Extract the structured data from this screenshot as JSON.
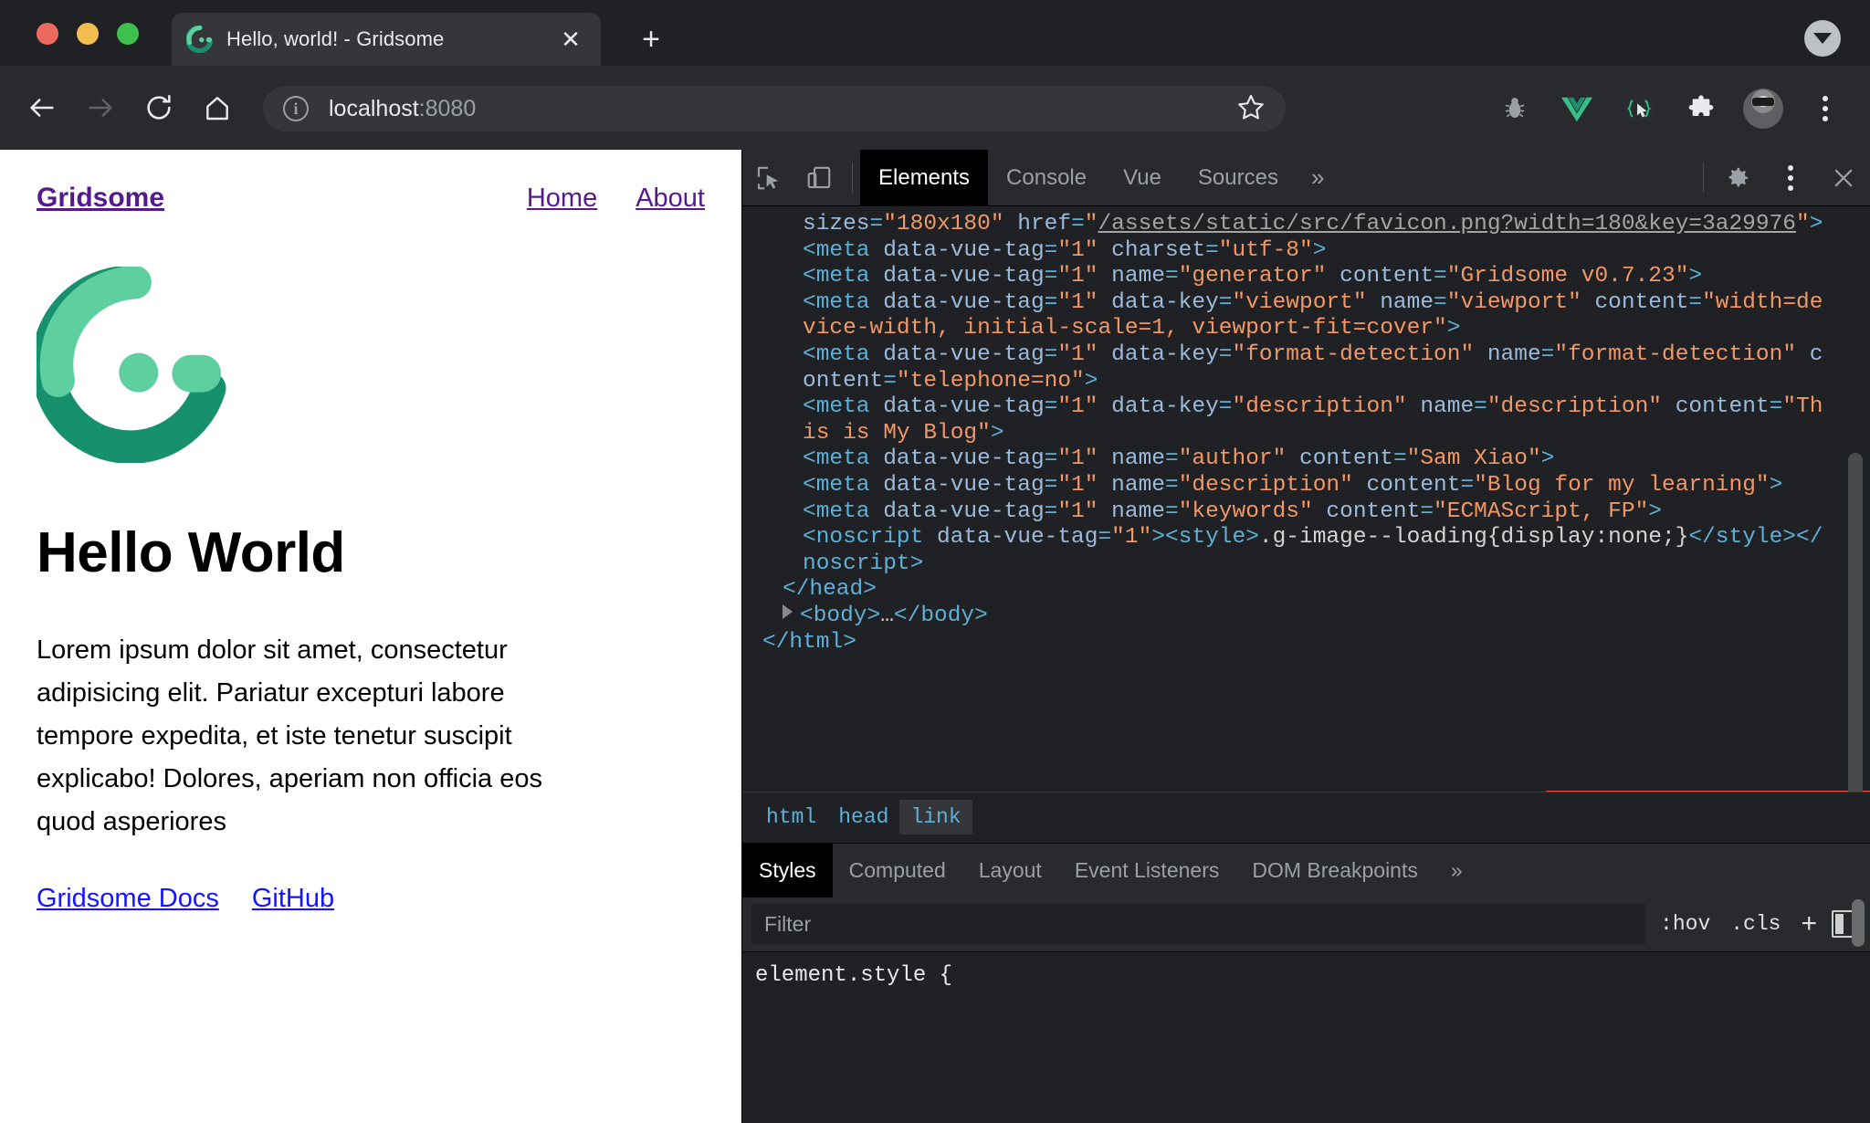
{
  "browser": {
    "window_controls": [
      "close",
      "minimize",
      "maximize"
    ],
    "tab": {
      "title": "Hello, world! - Gridsome",
      "favicon": "gridsome-logo-icon",
      "close_label": "✕"
    },
    "new_tab_label": "+",
    "tabstrip_caret": "chevron-down-icon",
    "nav": {
      "back": "back-arrow-icon",
      "forward": "forward-arrow-icon",
      "reload": "reload-icon",
      "home": "home-icon"
    },
    "omnibox": {
      "info_glyph": "i",
      "host": "localhost",
      "port": ":8080",
      "star": "star-icon"
    },
    "toolbar_icons": [
      "bug-icon",
      "vue-devtools-icon",
      "json-viewer-icon",
      "extensions-puzzle-icon",
      "profile-avatar",
      "chrome-menu-kebab"
    ]
  },
  "page": {
    "brand": "Gridsome",
    "nav": [
      {
        "label": "Home"
      },
      {
        "label": "About"
      }
    ],
    "logo": "gridsome-logo",
    "heading": "Hello World",
    "paragraph": "Lorem ipsum dolor sit amet, consectetur adipisicing elit. Pariatur excepturi labore tempore expedita, et iste tenetur suscipit explicabo! Dolores, aperiam non officia eos quod asperiores",
    "links": [
      {
        "label": "Gridsome Docs"
      },
      {
        "label": "GitHub"
      }
    ],
    "colors": {
      "visited_link": "#551a8b",
      "link": "#1414ff",
      "logo_light": "#5ecf9e",
      "logo_dark": "#17916d"
    }
  },
  "devtools": {
    "left_tools": [
      {
        "name": "inspect-element",
        "icon": "cursor-select-icon"
      },
      {
        "name": "device-toolbar",
        "icon": "device-toggle-icon"
      }
    ],
    "tabs": [
      {
        "label": "Elements",
        "active": true
      },
      {
        "label": "Console",
        "active": false
      },
      {
        "label": "Vue",
        "active": false
      },
      {
        "label": "Sources",
        "active": false
      }
    ],
    "more_tabs_label": "»",
    "right_tools": [
      {
        "name": "settings",
        "icon": "gear-icon"
      },
      {
        "name": "devtools-menu",
        "icon": "kebab-icon"
      },
      {
        "name": "close-devtools",
        "icon": "close-icon"
      }
    ],
    "dom_tree": {
      "lines": [
        {
          "indent": 2,
          "parts": [
            {
              "t": "attr",
              "v": "sizes"
            },
            {
              "t": "punct",
              "v": "="
            },
            {
              "t": "val",
              "v": "\"180x180\""
            },
            {
              "t": "plainsp",
              "v": " "
            },
            {
              "t": "attr",
              "v": "href"
            },
            {
              "t": "punct",
              "v": "="
            },
            {
              "t": "val",
              "v": "\""
            },
            {
              "t": "link",
              "v": "/assets/static/src/favicon.png?width=180&key=3a29976"
            },
            {
              "t": "val",
              "v": "\""
            },
            {
              "t": "punct",
              "v": ">"
            }
          ]
        },
        {
          "indent": 2,
          "parts": [
            {
              "t": "tag",
              "v": "<meta"
            },
            {
              "t": "plainsp",
              "v": " "
            },
            {
              "t": "attr",
              "v": "data-vue-tag"
            },
            {
              "t": "punct",
              "v": "="
            },
            {
              "t": "val",
              "v": "\"1\""
            },
            {
              "t": "plainsp",
              "v": " "
            },
            {
              "t": "attr",
              "v": "charset"
            },
            {
              "t": "punct",
              "v": "="
            },
            {
              "t": "val",
              "v": "\"utf-8\""
            },
            {
              "t": "tag",
              "v": ">"
            }
          ]
        },
        {
          "indent": 2,
          "parts": [
            {
              "t": "tag",
              "v": "<meta"
            },
            {
              "t": "plainsp",
              "v": " "
            },
            {
              "t": "attr",
              "v": "data-vue-tag"
            },
            {
              "t": "punct",
              "v": "="
            },
            {
              "t": "val",
              "v": "\"1\""
            },
            {
              "t": "plainsp",
              "v": " "
            },
            {
              "t": "attr",
              "v": "name"
            },
            {
              "t": "punct",
              "v": "="
            },
            {
              "t": "val",
              "v": "\"generator\""
            },
            {
              "t": "plainsp",
              "v": " "
            },
            {
              "t": "attr",
              "v": "content"
            },
            {
              "t": "punct",
              "v": "="
            },
            {
              "t": "val",
              "v": "\"Gridsome v0.7.23\""
            },
            {
              "t": "tag",
              "v": ">"
            }
          ]
        },
        {
          "indent": 2,
          "parts": [
            {
              "t": "tag",
              "v": "<meta"
            },
            {
              "t": "plainsp",
              "v": " "
            },
            {
              "t": "attr",
              "v": "data-vue-tag"
            },
            {
              "t": "punct",
              "v": "="
            },
            {
              "t": "val",
              "v": "\"1\""
            },
            {
              "t": "plainsp",
              "v": " "
            },
            {
              "t": "attr",
              "v": "data-key"
            },
            {
              "t": "punct",
              "v": "="
            },
            {
              "t": "val",
              "v": "\"viewport\""
            },
            {
              "t": "plainsp",
              "v": " "
            },
            {
              "t": "attr",
              "v": "name"
            },
            {
              "t": "punct",
              "v": "="
            },
            {
              "t": "val",
              "v": "\"viewport\""
            },
            {
              "t": "plainsp",
              "v": " "
            },
            {
              "t": "attr",
              "v": "content"
            },
            {
              "t": "punct",
              "v": "="
            },
            {
              "t": "val",
              "v": "\"width=device-width, initial-scale=1, viewport-fit=cover\""
            },
            {
              "t": "tag",
              "v": ">"
            }
          ]
        },
        {
          "indent": 2,
          "parts": [
            {
              "t": "tag",
              "v": "<meta"
            },
            {
              "t": "plainsp",
              "v": " "
            },
            {
              "t": "attr",
              "v": "data-vue-tag"
            },
            {
              "t": "punct",
              "v": "="
            },
            {
              "t": "val",
              "v": "\"1\""
            },
            {
              "t": "plainsp",
              "v": " "
            },
            {
              "t": "attr",
              "v": "data-key"
            },
            {
              "t": "punct",
              "v": "="
            },
            {
              "t": "val",
              "v": "\"format-detection\""
            },
            {
              "t": "plainsp",
              "v": " "
            },
            {
              "t": "attr",
              "v": "name"
            },
            {
              "t": "punct",
              "v": "="
            },
            {
              "t": "val",
              "v": "\"format-detection\""
            },
            {
              "t": "plainsp",
              "v": " "
            },
            {
              "t": "attr",
              "v": "content"
            },
            {
              "t": "punct",
              "v": "="
            },
            {
              "t": "val",
              "v": "\"telephone=no\""
            },
            {
              "t": "tag",
              "v": ">"
            }
          ]
        },
        {
          "indent": 2,
          "parts": [
            {
              "t": "tag",
              "v": "<meta"
            },
            {
              "t": "plainsp",
              "v": " "
            },
            {
              "t": "attr",
              "v": "data-vue-tag"
            },
            {
              "t": "punct",
              "v": "="
            },
            {
              "t": "val",
              "v": "\"1\""
            },
            {
              "t": "plainsp",
              "v": " "
            },
            {
              "t": "attr",
              "v": "data-key"
            },
            {
              "t": "punct",
              "v": "="
            },
            {
              "t": "val",
              "v": "\"description\""
            },
            {
              "t": "plainsp",
              "v": " "
            },
            {
              "t": "attr",
              "v": "name"
            },
            {
              "t": "punct",
              "v": "="
            },
            {
              "t": "val",
              "v": "\"description\""
            },
            {
              "t": "plainsp",
              "v": " "
            },
            {
              "t": "attr",
              "v": "content"
            },
            {
              "t": "punct",
              "v": "="
            },
            {
              "t": "val",
              "v": "\"This is My Blog\""
            },
            {
              "t": "tag",
              "v": ">"
            }
          ]
        },
        {
          "indent": 2,
          "highlight": true,
          "parts": [
            {
              "t": "tag",
              "v": "<meta"
            },
            {
              "t": "plainsp",
              "v": " "
            },
            {
              "t": "attr",
              "v": "data-vue-tag"
            },
            {
              "t": "punct",
              "v": "="
            },
            {
              "t": "val",
              "v": "\"1\""
            },
            {
              "t": "plainsp",
              "v": " "
            },
            {
              "t": "attr",
              "v": "name"
            },
            {
              "t": "punct",
              "v": "="
            },
            {
              "t": "val",
              "v": "\"author\""
            },
            {
              "t": "plainsp",
              "v": " "
            },
            {
              "t": "attr",
              "v": "content"
            },
            {
              "t": "punct",
              "v": "="
            },
            {
              "t": "val",
              "v": "\"Sam Xiao\""
            },
            {
              "t": "tag",
              "v": ">"
            }
          ]
        },
        {
          "indent": 2,
          "highlight": true,
          "parts": [
            {
              "t": "tag",
              "v": "<meta"
            },
            {
              "t": "plainsp",
              "v": " "
            },
            {
              "t": "attr",
              "v": "data-vue-tag"
            },
            {
              "t": "punct",
              "v": "="
            },
            {
              "t": "val",
              "v": "\"1\""
            },
            {
              "t": "plainsp",
              "v": " "
            },
            {
              "t": "attr",
              "v": "name"
            },
            {
              "t": "punct",
              "v": "="
            },
            {
              "t": "val",
              "v": "\"description\""
            },
            {
              "t": "plainsp",
              "v": " "
            },
            {
              "t": "attr",
              "v": "content"
            },
            {
              "t": "punct",
              "v": "="
            },
            {
              "t": "val",
              "v": "\"Blog for my learning\""
            },
            {
              "t": "tag",
              "v": ">"
            }
          ]
        },
        {
          "indent": 2,
          "highlight": true,
          "parts": [
            {
              "t": "tag",
              "v": "<meta"
            },
            {
              "t": "plainsp",
              "v": " "
            },
            {
              "t": "attr",
              "v": "data-vue-tag"
            },
            {
              "t": "punct",
              "v": "="
            },
            {
              "t": "val",
              "v": "\"1\""
            },
            {
              "t": "plainsp",
              "v": " "
            },
            {
              "t": "attr",
              "v": "name"
            },
            {
              "t": "punct",
              "v": "="
            },
            {
              "t": "val",
              "v": "\"keywords\""
            },
            {
              "t": "plainsp",
              "v": " "
            },
            {
              "t": "attr",
              "v": "content"
            },
            {
              "t": "punct",
              "v": "="
            },
            {
              "t": "val",
              "v": "\"ECMAScript, FP\""
            },
            {
              "t": "tag",
              "v": ">"
            }
          ]
        },
        {
          "indent": 2,
          "parts": [
            {
              "t": "tag",
              "v": "<noscript"
            },
            {
              "t": "plainsp",
              "v": " "
            },
            {
              "t": "attr",
              "v": "data-vue-tag"
            },
            {
              "t": "punct",
              "v": "="
            },
            {
              "t": "val",
              "v": "\"1\""
            },
            {
              "t": "tag",
              "v": ">"
            },
            {
              "t": "tag",
              "v": "<style>"
            },
            {
              "t": "plain",
              "v": ".g-image--loading{display:none;}"
            },
            {
              "t": "tag",
              "v": "</style></noscript>"
            }
          ]
        },
        {
          "indent": 1,
          "parts": [
            {
              "t": "tag",
              "v": "</head>"
            }
          ]
        },
        {
          "indent": 1,
          "expandable": true,
          "parts": [
            {
              "t": "tag",
              "v": "<body>"
            },
            {
              "t": "plain",
              "v": "…"
            },
            {
              "t": "tag",
              "v": "</body>"
            }
          ]
        },
        {
          "indent": 0,
          "parts": [
            {
              "t": "tag",
              "v": "</html>"
            }
          ]
        }
      ]
    },
    "breadcrumb": [
      "html",
      "head",
      "link"
    ],
    "breadcrumb_active": "link",
    "sidebar_tabs": [
      {
        "label": "Styles",
        "active": true
      },
      {
        "label": "Computed",
        "active": false
      },
      {
        "label": "Layout",
        "active": false
      },
      {
        "label": "Event Listeners",
        "active": false
      },
      {
        "label": "DOM Breakpoints",
        "active": false
      }
    ],
    "sidebar_more_label": "»",
    "filter": {
      "placeholder": "Filter",
      "value": "",
      "hov_label": ":hov",
      "cls_label": ".cls",
      "new_rule_label": "+",
      "dock_icon": "dock-side-icon"
    },
    "styles_body": "element.style {"
  }
}
